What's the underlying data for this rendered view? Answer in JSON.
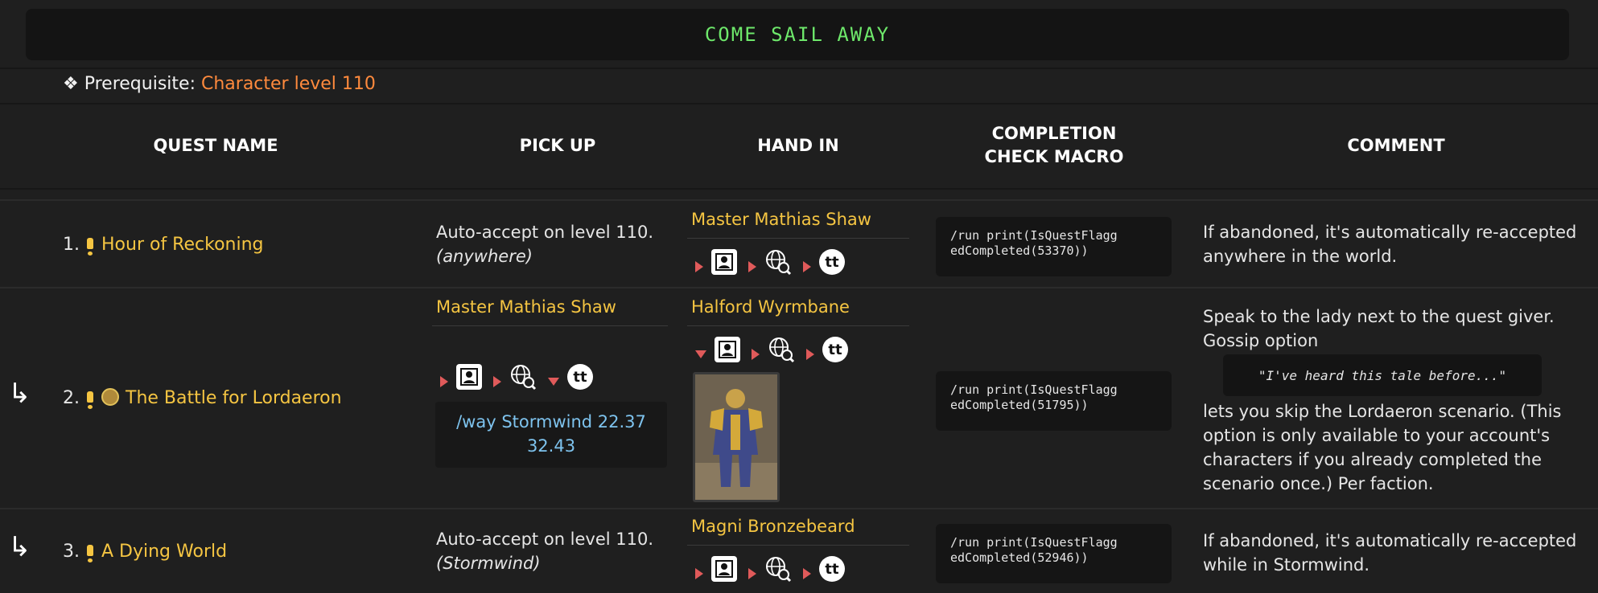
{
  "banner": {
    "title": "COME SAIL AWAY"
  },
  "prereq": {
    "bullet": "❖",
    "label": "Prerequisite:",
    "value": "Character level 110"
  },
  "headers": {
    "quest_name": "QUEST NAME",
    "pick_up": "PICK UP",
    "hand_in": "HAND IN",
    "macro_line1": "COMPLETION",
    "macro_line2": "CHECK MACRO",
    "comment": "COMMENT"
  },
  "quests": [
    {
      "num": "1.",
      "name": "Hour of Reckoning",
      "pickup_line1": "Auto-accept on level 110.",
      "pickup_line2": "(anywhere)",
      "handin_npc": "Master Mathias Shaw",
      "macro_line1": "/run print(IsQuestFlagg",
      "macro_line2": "edCompleted(53370))",
      "comment_line1": "If abandoned, it's automatically re-accepted",
      "comment_line2": "anywhere in the world."
    },
    {
      "num": "2.",
      "name": "The Battle for Lordaeron",
      "pickup_npc": "Master Mathias Shaw",
      "waypoint_line1": "/way Stormwind 22.37",
      "waypoint_line2": "32.43",
      "handin_npc": "Halford Wyrmbane",
      "macro_line1": "/run print(IsQuestFlagg",
      "macro_line2": "edCompleted(51795))",
      "comment_line1": "Speak to the lady next to the quest giver.",
      "comment_line2": "Gossip option",
      "gossip": "\"I've heard this tale before...\"",
      "comment_line3": "lets you skip the Lordaeron scenario. (This",
      "comment_line4": "option is only available to your account's",
      "comment_line5": "characters if you already completed the",
      "comment_line6": "scenario once.) Per faction."
    },
    {
      "num": "3.",
      "name": "A Dying World",
      "pickup_line1": "Auto-accept on level 110.",
      "pickup_line2": "(Stormwind)",
      "handin_npc": "Magni Bronzebeard",
      "macro_line1": "/run print(IsQuestFlagg",
      "macro_line2": "edCompleted(52946))",
      "comment_line1": "If abandoned, it's automatically re-accepted",
      "comment_line2": "while in Stormwind."
    }
  ],
  "icons": [
    "marker-triangle-icon",
    "npc-portrait-icon",
    "globe-search-icon",
    "tt-icon",
    "quest-available-icon",
    "alliance-icon",
    "arrow-return-icon"
  ],
  "colors": {
    "accent_green": "#6ee86b",
    "quest_yellow": "#f5c542",
    "prereq_orange": "#ff8a3d",
    "waypoint_blue": "#7ec3ee"
  }
}
